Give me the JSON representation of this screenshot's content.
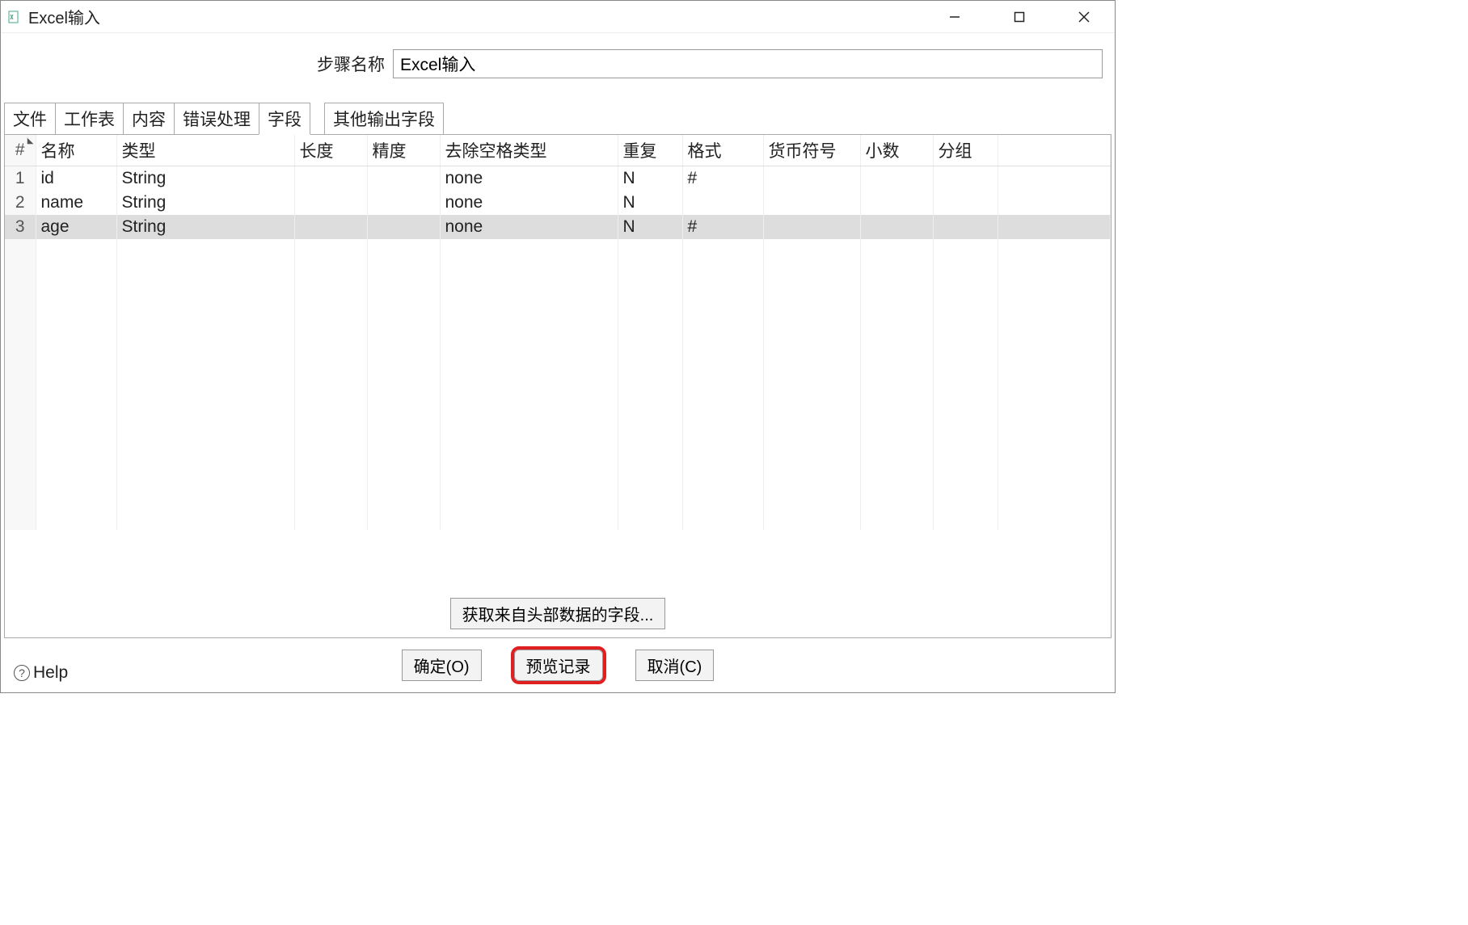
{
  "window": {
    "title": "Excel输入"
  },
  "step": {
    "label": "步骤名称",
    "value": "Excel输入"
  },
  "tabs": {
    "file": "文件",
    "sheet": "工作表",
    "content": "内容",
    "error": "错误处理",
    "fields": "字段",
    "otherOutput": "其他输出字段"
  },
  "grid": {
    "headers": {
      "num": "#",
      "name": "名称",
      "type": "类型",
      "length": "长度",
      "precision": "精度",
      "trim": "去除空格类型",
      "repeat": "重复",
      "format": "格式",
      "currency": "货币符号",
      "decimal": "小数",
      "group": "分组"
    },
    "rows": [
      {
        "num": "1",
        "name": "id",
        "type": "String",
        "length": "",
        "precision": "",
        "trim": "none",
        "repeat": "N",
        "format": "#",
        "currency": "",
        "decimal": "",
        "group": ""
      },
      {
        "num": "2",
        "name": "name",
        "type": "String",
        "length": "",
        "precision": "",
        "trim": "none",
        "repeat": "N",
        "format": "",
        "currency": "",
        "decimal": "",
        "group": ""
      },
      {
        "num": "3",
        "name": "age",
        "type": "String",
        "length": "",
        "precision": "",
        "trim": "none",
        "repeat": "N",
        "format": "#",
        "currency": "",
        "decimal": "",
        "group": ""
      }
    ],
    "selectedRow": 2
  },
  "buttons": {
    "getHeaderFields": "获取来自头部数据的字段...",
    "ok": "确定(O)",
    "preview": "预览记录",
    "cancel": "取消(C)"
  },
  "help": {
    "label": "Help"
  }
}
